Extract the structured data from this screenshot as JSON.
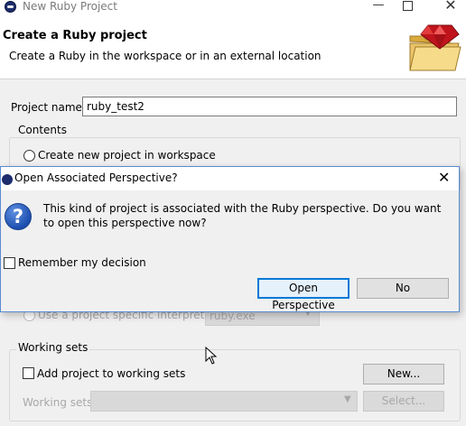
{
  "window": {
    "title": "New Ruby Project",
    "controls": {
      "minimize": "—",
      "close": "✕"
    }
  },
  "header": {
    "title": "Create a Ruby project",
    "description": "Create a Ruby in the workspace or in an external location"
  },
  "form": {
    "project_name_label": "Project name:",
    "project_name_value": "ruby_test2"
  },
  "contents": {
    "legend": "Contents",
    "create_new_label": "Create new project in workspace"
  },
  "interpreter": {
    "label": "Use a project specific interpreter:",
    "value": "ruby.exe"
  },
  "working_sets": {
    "legend": "Working sets",
    "add_label": "Add project to working sets",
    "new_button": "New...",
    "working_sets_label": "Working sets:",
    "select_button": "Select..."
  },
  "dialog": {
    "title": "Open Associated Perspective?",
    "close": "✕",
    "icon_glyph": "?",
    "message": "This kind of project is associated with the Ruby perspective.  Do you want to open this perspective now?",
    "remember_label": "Remember my decision",
    "open_button": "Open Perspective",
    "no_button": "No"
  },
  "colors": {
    "accent": "#0078d7",
    "question_icon": "#1d4fb0"
  },
  "icons": [
    "ruby-app-icon",
    "wizard-folder-ruby-icon",
    "question-icon",
    "mouse-cursor-icon"
  ]
}
